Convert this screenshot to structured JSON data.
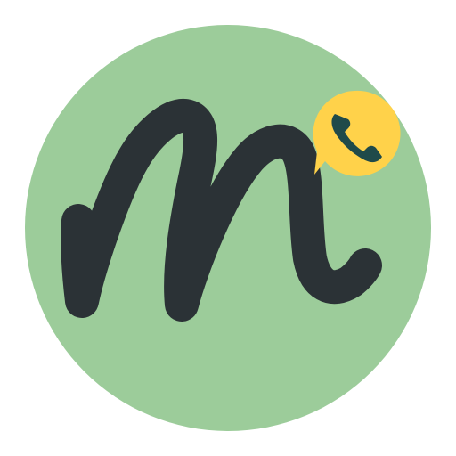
{
  "icon": {
    "name": "app-logo",
    "glyph": "script-m",
    "badge": "phone-in-speech-bubble",
    "colors": {
      "background": "#ffffff",
      "circle": "#9ccc9a",
      "letter": "#2b3236",
      "bubble": "#ffd24a",
      "phone": "#1f4a4a"
    }
  }
}
